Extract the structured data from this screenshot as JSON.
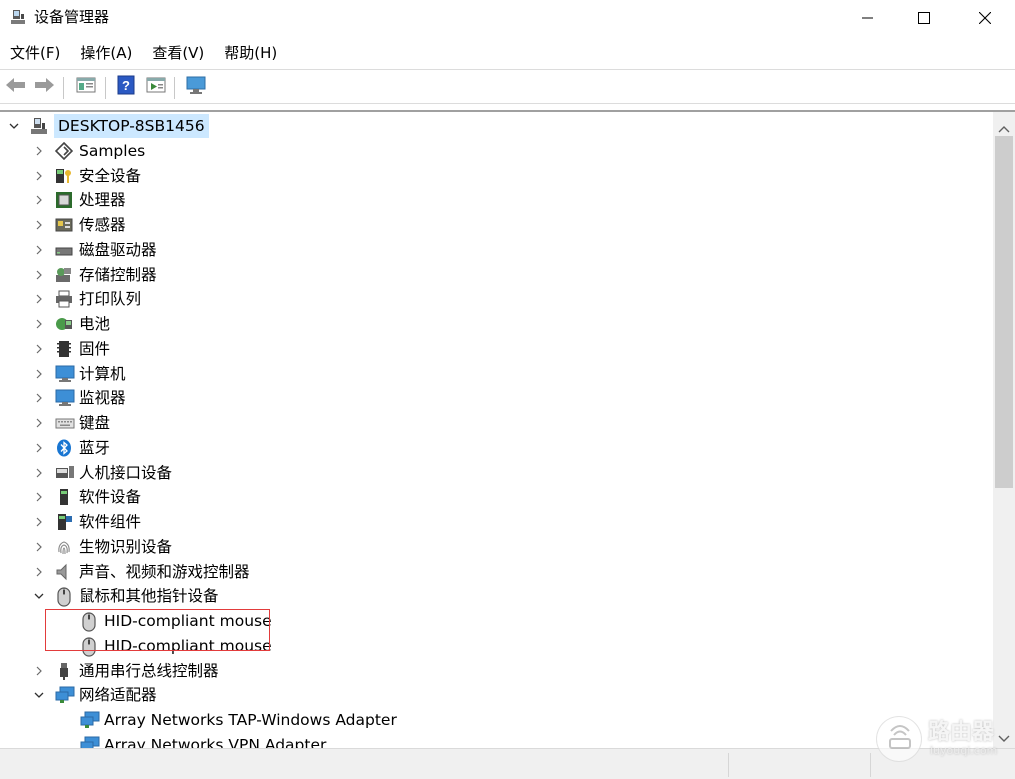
{
  "window": {
    "title": "设备管理器",
    "controls": [
      "minimize",
      "maximize",
      "close"
    ]
  },
  "menu": [
    {
      "label": "文件(F)"
    },
    {
      "label": "操作(A)"
    },
    {
      "label": "查看(V)"
    },
    {
      "label": "帮助(H)"
    }
  ],
  "toolbar": {
    "buttons": [
      "back-icon",
      "forward-icon",
      "properties-icon",
      "help-icon",
      "run-icon",
      "monitor-icon"
    ]
  },
  "tree": {
    "root": {
      "label": "DESKTOP-8SB1456",
      "expanded": true
    },
    "items": [
      {
        "label": "Samples",
        "icon": "samples-icon",
        "expanded": false
      },
      {
        "label": "安全设备",
        "icon": "security-device-icon",
        "expanded": false
      },
      {
        "label": "处理器",
        "icon": "processor-icon",
        "expanded": false
      },
      {
        "label": "传感器",
        "icon": "sensor-icon",
        "expanded": false
      },
      {
        "label": "磁盘驱动器",
        "icon": "disk-drive-icon",
        "expanded": false
      },
      {
        "label": "存储控制器",
        "icon": "storage-controller-icon",
        "expanded": false
      },
      {
        "label": "打印队列",
        "icon": "printer-icon",
        "expanded": false
      },
      {
        "label": "电池",
        "icon": "battery-icon",
        "expanded": false
      },
      {
        "label": "固件",
        "icon": "firmware-icon",
        "expanded": false
      },
      {
        "label": "计算机",
        "icon": "computer-icon",
        "expanded": false
      },
      {
        "label": "监视器",
        "icon": "monitor-icon",
        "expanded": false
      },
      {
        "label": "键盘",
        "icon": "keyboard-icon",
        "expanded": false
      },
      {
        "label": "蓝牙",
        "icon": "bluetooth-icon",
        "expanded": false
      },
      {
        "label": "人机接口设备",
        "icon": "hid-icon",
        "expanded": false
      },
      {
        "label": "软件设备",
        "icon": "software-device-icon",
        "expanded": false
      },
      {
        "label": "软件组件",
        "icon": "software-component-icon",
        "expanded": false
      },
      {
        "label": "生物识别设备",
        "icon": "biometric-icon",
        "expanded": false
      },
      {
        "label": "声音、视频和游戏控制器",
        "icon": "audio-icon",
        "expanded": false
      },
      {
        "label": "鼠标和其他指针设备",
        "icon": "mouse-icon",
        "expanded": true,
        "children": [
          {
            "label": "HID-compliant mouse",
            "icon": "mouse-icon"
          },
          {
            "label": "HID-compliant mouse",
            "icon": "mouse-icon"
          }
        ]
      },
      {
        "label": "通用串行总线控制器",
        "icon": "usb-icon",
        "expanded": false
      },
      {
        "label": "网络适配器",
        "icon": "network-adapter-icon",
        "expanded": true,
        "children": [
          {
            "label": "Array Networks TAP-Windows Adapter",
            "icon": "network-adapter-icon"
          },
          {
            "label": "Array Networks VPN Adapter",
            "icon": "network-adapter-icon"
          }
        ]
      }
    ]
  },
  "watermark": {
    "text": "路由器",
    "sub": "luyouqi.com"
  },
  "colors": {
    "selection": "#cce8ff",
    "highlight_box": "#e23b3b"
  }
}
